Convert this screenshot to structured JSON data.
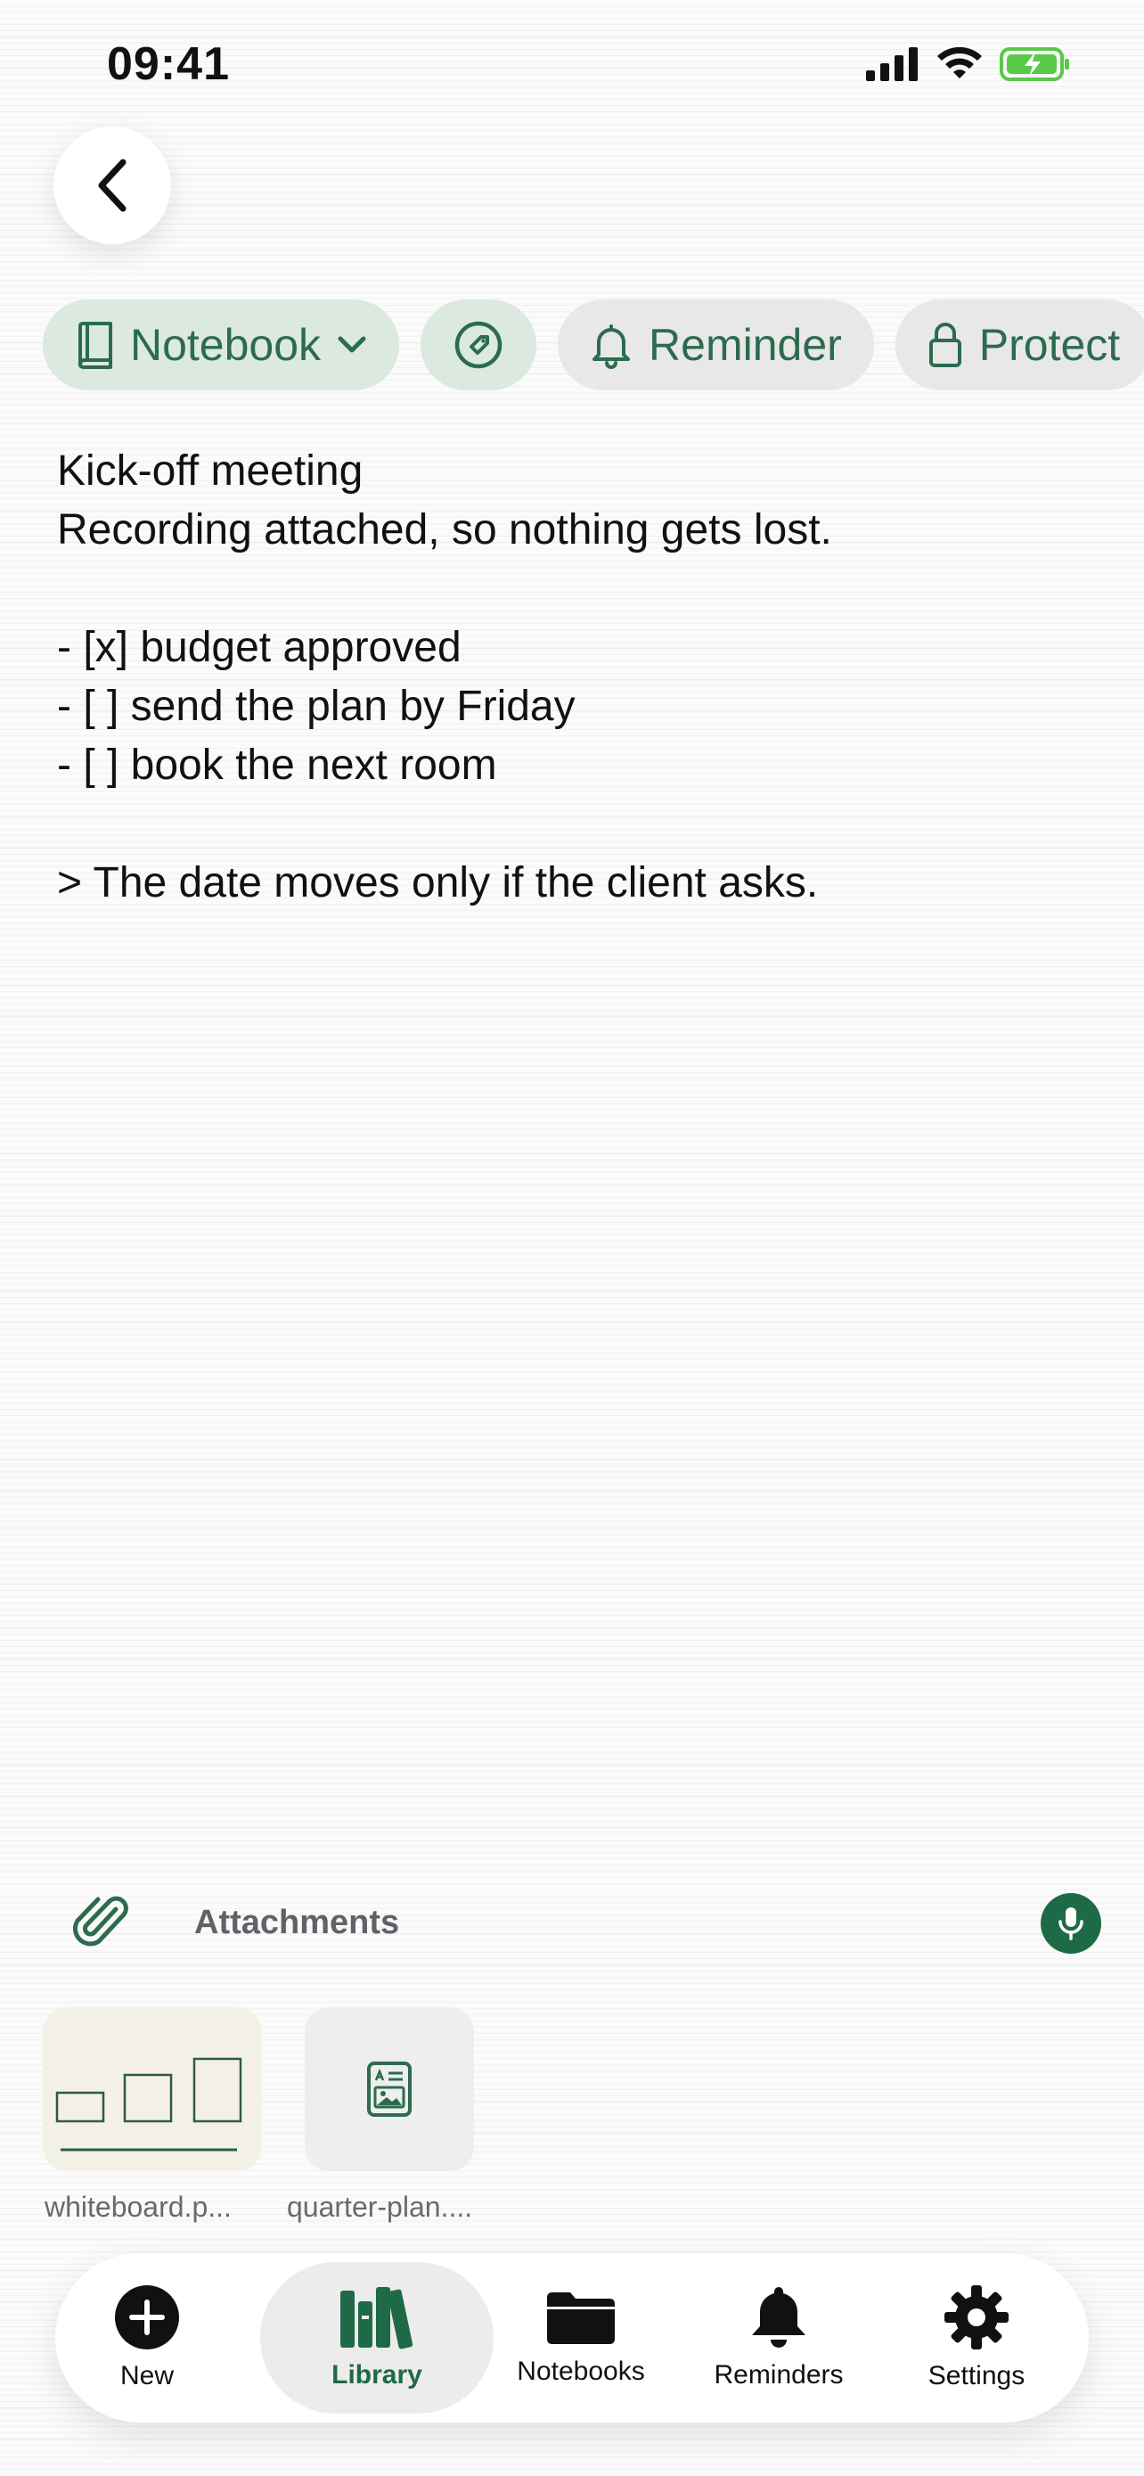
{
  "status_bar": {
    "time": "09:41"
  },
  "chips": {
    "notebook": "Notebook",
    "reminder": "Reminder",
    "protect": "Protect"
  },
  "note": {
    "lines": [
      "Kick-off meeting",
      "Recording attached, so nothing gets lost.",
      "",
      "- [x] budget approved",
      "- [ ] send the plan by Friday",
      "- [ ] book the next room",
      "",
      "> The date moves only if the client asks."
    ]
  },
  "attachments": {
    "label": "Attachments",
    "files": [
      {
        "name": "whiteboard.p..."
      },
      {
        "name": "quarter-plan...."
      }
    ]
  },
  "tabbar": {
    "items": [
      {
        "label": "New"
      },
      {
        "label": "Library"
      },
      {
        "label": "Notebooks"
      },
      {
        "label": "Reminders"
      },
      {
        "label": "Settings"
      }
    ],
    "active": "Library"
  },
  "colors": {
    "accent": "#1f6a46",
    "chip_green": "#dbe9e0",
    "chip_grey": "#e8e8e8",
    "battery_green": "#5ac84a"
  }
}
